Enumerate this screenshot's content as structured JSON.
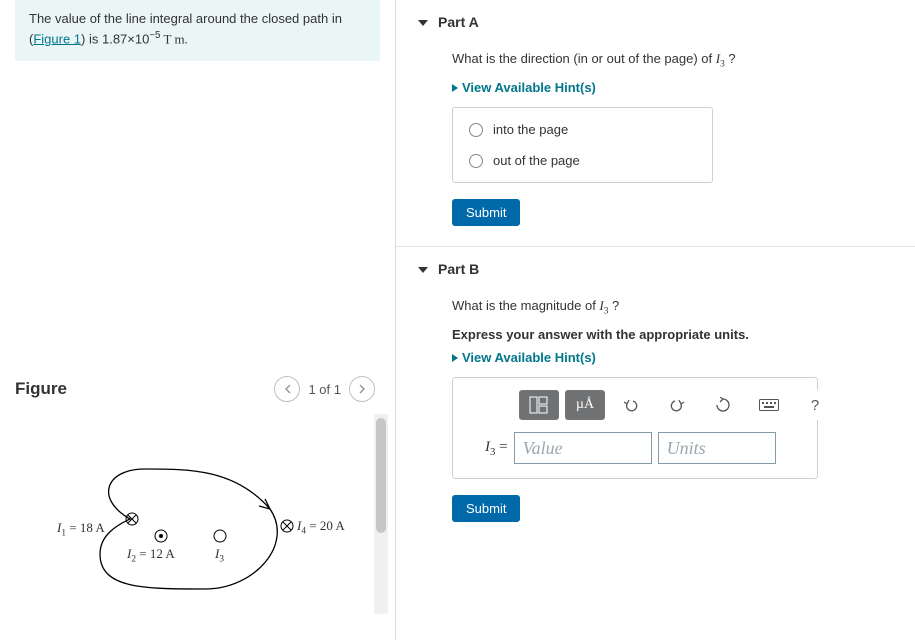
{
  "problem": {
    "text_pre": "The value of the line integral around the closed path in (",
    "link_text": "Figure 1",
    "text_post_link": ") is 1.87×10",
    "exp": "−5",
    "unit": " T m."
  },
  "figure": {
    "title": "Figure",
    "pager": "1 of 1",
    "labels": {
      "i1_pre": "I",
      "i1_sub": "1",
      "i1_post": " = 18 A",
      "i2_pre": "I",
      "i2_sub": "2",
      "i2_post": " = 12 A",
      "i3_pre": "I",
      "i3_sub": "3",
      "i4_pre": "I",
      "i4_sub": "4",
      "i4_post": " = 20 A"
    }
  },
  "partA": {
    "title": "Part A",
    "prompt_pre": "What is the direction (in or out of the page) of ",
    "prompt_var_letter": "I",
    "prompt_var_sub": "3",
    "prompt_post": " ?",
    "hints_label": "View Available Hint(s)",
    "choice1": "into the page",
    "choice2": "out of the page",
    "submit": "Submit"
  },
  "partB": {
    "title": "Part B",
    "prompt_pre": "What is the magnitude of ",
    "prompt_var_letter": "I",
    "prompt_var_sub": "3",
    "prompt_post": " ?",
    "instruction": "Express your answer with the appropriate units.",
    "hints_label": "View Available Hint(s)",
    "eq_label_letter": "I",
    "eq_label_sub": "3",
    "eq_label_post": " =",
    "value_placeholder": "Value",
    "units_placeholder": "Units",
    "tool_units": "µÅ",
    "tool_help": "?",
    "submit": "Submit"
  }
}
